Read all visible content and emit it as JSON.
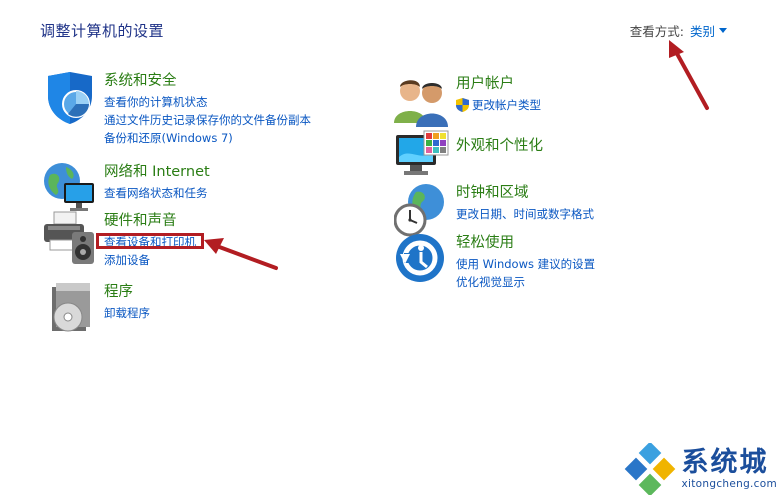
{
  "page": {
    "title": "调整计算机的设置"
  },
  "view_by": {
    "label": "查看方式:",
    "value": "类别"
  },
  "left_categories": [
    {
      "title": "系统和安全",
      "icon": "shield-icon",
      "links": [
        "查看你的计算机状态",
        "通过文件历史记录保存你的文件备份副本",
        "备份和还原(Windows 7)"
      ]
    },
    {
      "title": "网络和 Internet",
      "icon": "network-globe-icon",
      "links": [
        "查看网络状态和任务"
      ]
    },
    {
      "title": "硬件和声音",
      "icon": "printer-speaker-icon",
      "links": [
        "查看设备和打印机",
        "添加设备"
      ]
    },
    {
      "title": "程序",
      "icon": "programs-disc-icon",
      "links": [
        "卸载程序"
      ]
    }
  ],
  "right_categories": [
    {
      "title": "用户帐户",
      "icon": "users-icon",
      "links": [
        "更改帐户类型"
      ]
    },
    {
      "title": "外观和个性化",
      "icon": "monitor-palette-icon",
      "links": []
    },
    {
      "title": "时钟和区域",
      "icon": "clock-globe-icon",
      "links": [
        "更改日期、时间或数字格式"
      ]
    },
    {
      "title": "轻松使用",
      "icon": "ease-of-access-icon",
      "links": [
        "使用 Windows 建议的设置",
        "优化视觉显示"
      ]
    }
  ],
  "watermark": {
    "cn": "系统城",
    "en": "xitongcheng.com"
  },
  "colors": {
    "title_blue": "#1e3287",
    "category_green": "#2a7d14",
    "link_blue": "#0a57c2",
    "annotation_red": "#b21d22"
  }
}
